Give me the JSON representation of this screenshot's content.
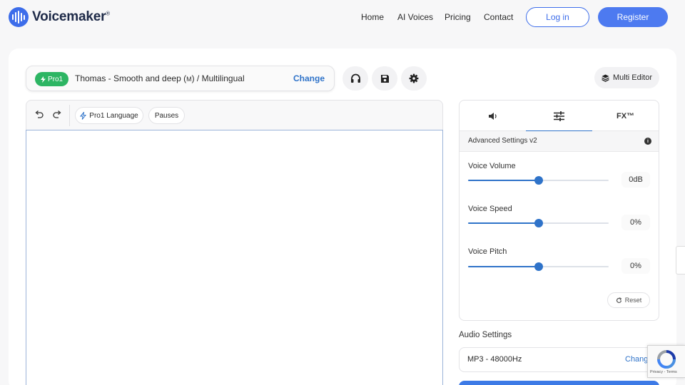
{
  "brand": {
    "name": "Voicemaker",
    "reg": "®"
  },
  "nav": {
    "home": "Home",
    "ai_voices": "AI Voices",
    "pricing": "Pricing",
    "contact": "Contact",
    "login": "Log in",
    "register": "Register"
  },
  "voice": {
    "badge": "Pro1",
    "name": "Thomas - Smooth and deep (",
    "gender": "M",
    "suffix": ") / Multilingual",
    "change": "Change"
  },
  "toolbar_icons": [
    "headphones-icon",
    "save-icon",
    "settings-gear-icon"
  ],
  "multi_editor": "Multi Editor",
  "editor": {
    "pro_language": "Pro1 Language",
    "pauses": "Pauses",
    "text": ""
  },
  "settings": {
    "tabs": [
      {
        "icon": "volume-icon"
      },
      {
        "icon": "sliders-icon",
        "active": true
      },
      {
        "label": "FX™"
      }
    ],
    "advanced_label": "Advanced Settings v2",
    "info": "i",
    "sliders": [
      {
        "label": "Voice Volume",
        "value": "0dB",
        "level": 0.5
      },
      {
        "label": "Voice Speed",
        "value": "0%",
        "level": 0.5
      },
      {
        "label": "Voice Pitch",
        "value": "0%",
        "level": 0.5
      }
    ],
    "reset": "Reset"
  },
  "audio": {
    "title": "Audio Settings",
    "format": "MP3 - 48000Hz",
    "change": "Chang"
  },
  "recaptcha": {
    "links": "Privacy - Terms"
  },
  "colors": {
    "accent": "#2f73c9",
    "brand": "#3d6dea",
    "badge_green": "#2db563"
  }
}
